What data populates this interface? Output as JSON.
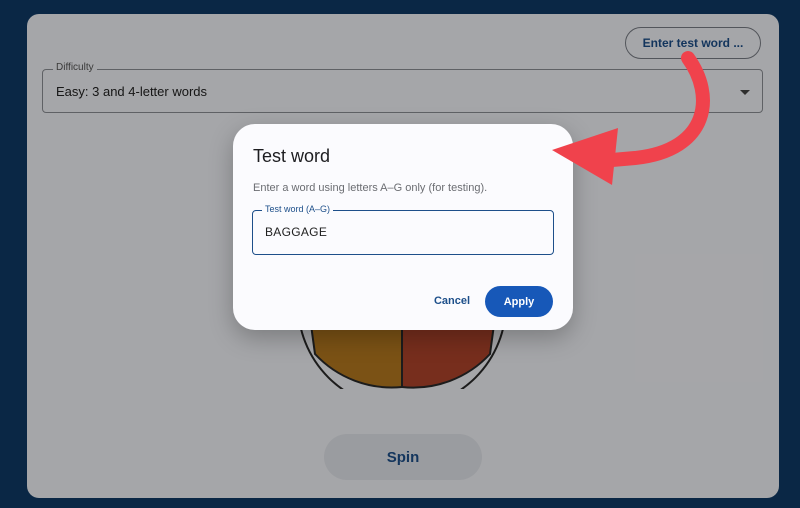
{
  "app": {
    "test_word_button": "Enter test word ...",
    "difficulty": {
      "label": "Difficulty",
      "value": "Easy: 3 and 4-letter words"
    },
    "wheel": {
      "segment_colors": [
        "#b5791f",
        "#b0452c"
      ]
    },
    "spin_button": "Spin"
  },
  "dialog": {
    "title": "Test word",
    "description": "Enter a word using letters A–G only (for testing).",
    "field": {
      "label": "Test word (A–G)",
      "value": "BAGGAGE"
    },
    "cancel_label": "Cancel",
    "apply_label": "Apply"
  },
  "colors": {
    "accent": "#1758b8",
    "text_link": "#1d4f8a",
    "annotation_arrow": "#f0424c",
    "page_background": "#0f3a66"
  }
}
